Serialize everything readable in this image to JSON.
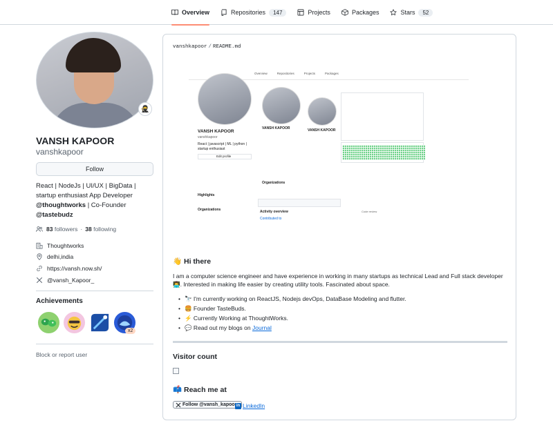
{
  "nav": {
    "tabs": [
      {
        "label": "Overview",
        "icon": "book-icon",
        "active": true
      },
      {
        "label": "Repositories",
        "icon": "repo-icon",
        "count": "147"
      },
      {
        "label": "Projects",
        "icon": "table-icon"
      },
      {
        "label": "Packages",
        "icon": "package-icon"
      },
      {
        "label": "Stars",
        "icon": "star-icon",
        "count": "52"
      }
    ]
  },
  "profile": {
    "status_emoji": "🥷",
    "full_name": "VANSH KAPOOR",
    "username": "vanshkapoor",
    "follow_label": "Follow",
    "bio_line1": "React | NodeJs | UI/UX | BigData | startup enthusiast App Developer",
    "bio_org1": "@thoughtworks",
    "bio_mid": " | Co-Founder",
    "bio_org2": "@tastebudz",
    "followers_count": "83",
    "followers_label": "followers",
    "following_count": "38",
    "following_label": "following",
    "company": "Thoughtworks",
    "location": "delhi,india",
    "website": "https://vansh.now.sh/",
    "twitter": "@vansh_Kapoor_"
  },
  "achievements": {
    "title": "Achievements",
    "badges": [
      "pair-extraordinaire",
      "yolo",
      "starstruck",
      "pull-shark"
    ],
    "multiplier": "x2"
  },
  "block_link": "Block or report user",
  "readme": {
    "breadcrumb_user": "vanshkapoor",
    "breadcrumb_sep": "/",
    "breadcrumb_file": "README.md",
    "hi_heading": "👋 Hi there",
    "intro": "I am a computer science engineer and have experience in working in many startups as technical Lead and Full stack developer👨‍💻. Interested in making life easier by creating utility tools. Fascinated about space.",
    "list": [
      {
        "text": "🔭 I'm currently working on ReactJS, Nodejs devOps, DataBase Modeling and flutter."
      },
      {
        "text": "🍔 Founder TasteBuds."
      },
      {
        "text": "⚡ Currently Working at ThoughtWorks."
      },
      {
        "text": "💬 Read out my blogs on ",
        "link": "Journal"
      }
    ],
    "visitor_heading": "Visitor count",
    "reach_heading": "📫 Reach me at",
    "twitter_button": "Follow @vansh_kapoor_",
    "linkedin": "LinkedIn"
  },
  "screenshot": {
    "tabs": [
      "Overview",
      "Repositories",
      "Projects",
      "Packages"
    ],
    "name": "VANSH KAPOOR",
    "user": "vanshkapoor",
    "bio": "React | javascript | ML | python |",
    "bio2": "startup enthusiast",
    "edit": "Edit profile",
    "highlights": "Highlights",
    "orgs": "Organizations",
    "activity": "Activity overview",
    "contributed": "Contributed to",
    "code_review": "Code review"
  },
  "colors": {
    "accent": "#fd8c73",
    "link": "#0969da",
    "muted": "#59636e",
    "border": "#d0d7de"
  }
}
